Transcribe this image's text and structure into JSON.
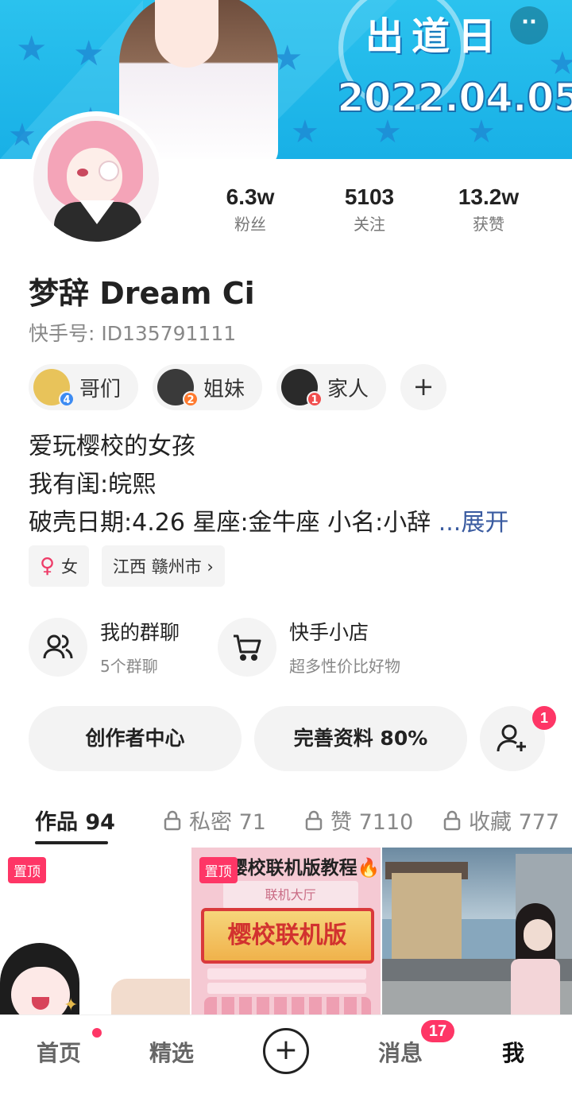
{
  "banner": {
    "title": "出道日",
    "date": "2022.04.05",
    "more_button": "··"
  },
  "stats": [
    {
      "value": "6.3w",
      "label": "粉丝"
    },
    {
      "value": "5103",
      "label": "关注"
    },
    {
      "value": "13.2w",
      "label": "获赞"
    }
  ],
  "profile": {
    "name": "梦辞 Dream Ci",
    "kuaishou_id": "快手号: ID135791111"
  },
  "relations": [
    {
      "label": "哥们",
      "count": "4",
      "badge_color": "#3d8bf2",
      "avatar_color": "#e8c35a"
    },
    {
      "label": "姐妹",
      "count": "2",
      "badge_color": "#ff7a2e",
      "avatar_color": "#3a3a3a"
    },
    {
      "label": "家人",
      "count": "1",
      "badge_color": "#f14e4e",
      "avatar_color": "#2a2a2a"
    }
  ],
  "add_relation_icon": "plus-icon",
  "bio": {
    "line1": "爱玩樱校的女孩",
    "line2": "我有闺:皖熙",
    "line3": "破壳日期:4.26 星座:金牛座 小名:小辞 ",
    "expand": "...展开"
  },
  "tags": {
    "gender": "女",
    "location": "江西 赣州市 ›"
  },
  "features": [
    {
      "title": "我的群聊",
      "subtitle": "5个群聊",
      "icon": "users-icon"
    },
    {
      "title": "快手小店",
      "subtitle": "超多性价比好物",
      "icon": "cart-icon"
    }
  ],
  "actions": {
    "creator_center": "创作者中心",
    "complete_profile": "完善资料 80%",
    "add_friend_badge": "1"
  },
  "tabs": [
    {
      "label": "作品 94",
      "locked": false,
      "active": true
    },
    {
      "label": "私密 71",
      "locked": true,
      "active": false
    },
    {
      "label": "赞 7110",
      "locked": true,
      "active": false
    },
    {
      "label": "收藏 777",
      "locked": true,
      "active": false
    }
  ],
  "works": [
    {
      "pinned": "置顶"
    },
    {
      "pinned": "置顶",
      "title": "樱校联机版教程🔥",
      "hall": "联机大厅",
      "scroll_text": "樱校联机版"
    },
    {}
  ],
  "bottom_nav": {
    "home": "首页",
    "featured": "精选",
    "messages": "消息",
    "messages_count": "17",
    "me": "我"
  },
  "colors": {
    "accent": "#fe3666",
    "banner": "#1fb4e8",
    "expand_link": "#3a5ba0"
  }
}
